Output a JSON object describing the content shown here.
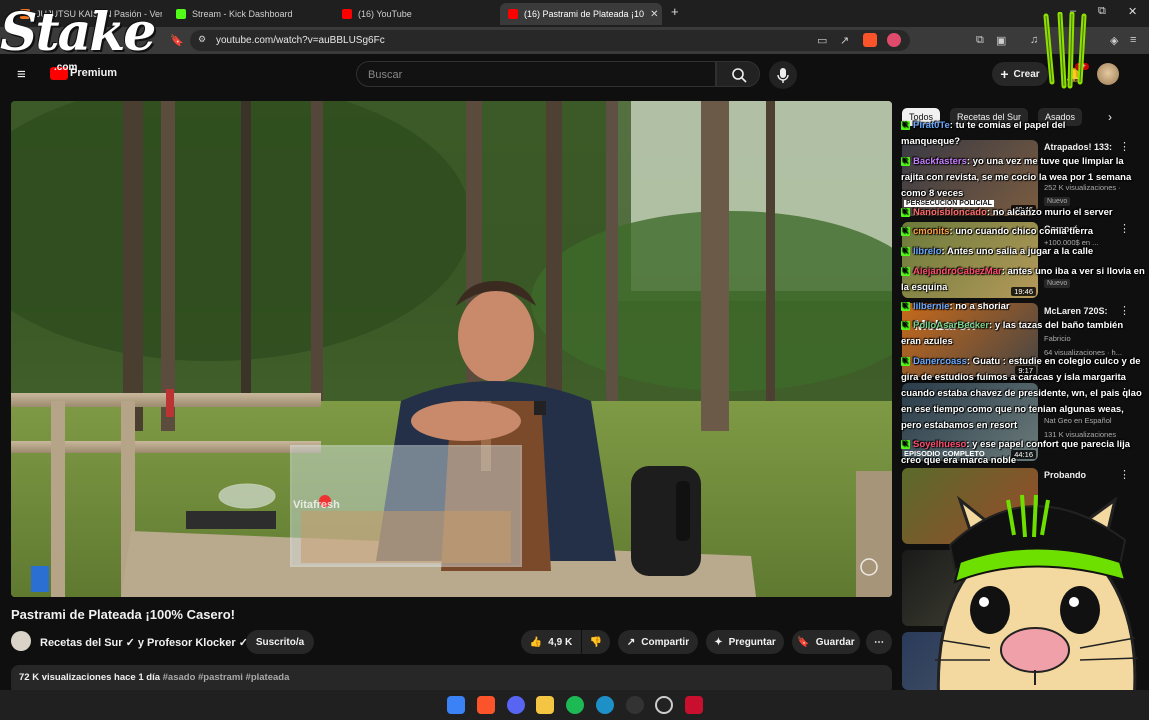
{
  "browser": {
    "tabs": [
      {
        "label": "JUJUTSU KAISEN Pasión - Ver en Cru",
        "color": "#f47521"
      },
      {
        "label": "Stream - Kick Dashboard",
        "color": "#53fc18"
      },
      {
        "label": "(16) YouTube",
        "color": "#ff0000"
      },
      {
        "label": "(16) Pastrami de Plateada ¡10",
        "color": "#ff0000"
      }
    ],
    "url": "youtube.com/watch?v=auBBLUSg6Fc",
    "new_tab": "+",
    "window_controls": [
      "–",
      "⧉",
      "✕"
    ]
  },
  "youtube": {
    "logo_badge": "Premium",
    "search_placeholder": "Buscar",
    "create_label": "Crear",
    "notif_count": "9+"
  },
  "video": {
    "title": "Pastrami de Plateada ¡100% Casero!",
    "channel": "Recetas del Sur ✓ y Profesor Klocker ✓",
    "subscribe_label": "Suscrito/a",
    "likes": "4,9 K",
    "share_label": "Compartir",
    "ask_label": "Preguntar",
    "save_label": "Guardar",
    "views_line": "72 K visualizaciones  hace 1 día",
    "tags": "#asado #pastrami #plateada",
    "box_text": "Vitafresh"
  },
  "chips": [
    "Todos",
    "Recetas del Sur",
    "Asados"
  ],
  "recommended": [
    {
      "title": "Atrapados! 133:",
      "meta": "252 K visualizaciones ·",
      "badge": "Nuevo",
      "duration": "40:46",
      "thumb_text": "PERSECUCIÓN POLICIAL"
    },
    {
      "title": "Compré",
      "meta": "+100.000$ en ...",
      "badge": "Nuevo",
      "duration": "19:46",
      "thumb_text": ""
    },
    {
      "title": "McLaren 720S:",
      "meta": "64 visualizaciones · h...",
      "sub": "Fabricio",
      "badge": "",
      "duration": "9:17",
      "thumb_text": "McLaren"
    },
    {
      "title": "",
      "meta": "131 K visualizaciones",
      "sub": "Nat Geo en Español",
      "badge": "",
      "duration": "44:16",
      "thumb_text": "EPISODIO COMPLETO"
    },
    {
      "title": "Probando",
      "meta": "",
      "badge": "",
      "duration": "",
      "thumb_text": ""
    }
  ],
  "chat": [
    {
      "user": "Pirat0Te",
      "color": "#6aa9ff",
      "text": ": tu te comias el papel del manqueque?",
      "wrap": true
    },
    {
      "user": "Backfasters",
      "color": "#c77dff",
      "text": ": yo una vez me tuve que limpiar la rajita con revista, se me cocio la wea por 1 semana como 8 veces",
      "wrap": true
    },
    {
      "user": "Nanoisbloncado",
      "color": "#ff6b6b",
      "text": ": no alcanzo murio el server",
      "wrap": false
    },
    {
      "user": "cmonits",
      "color": "#ff9f43",
      "text": ": uno cuando chico comia tierra",
      "wrap": false
    },
    {
      "user": "librelo",
      "color": "#6aa9ff",
      "text": ": Antes uno salia a jugar a la calle",
      "wrap": false
    },
    {
      "user": "AlejandroCabezMar",
      "color": "#ff4d6d",
      "text": ": antes uno iba a ver si llovia en la esquina",
      "wrap": true
    },
    {
      "user": "lilbernie",
      "color": "#6aa9ff",
      "text": ": no a shoriar",
      "wrap": false
    },
    {
      "user": "PolloAsarBecker",
      "color": "#7bd389",
      "text": ": y las tazas del baño también eran azules",
      "wrap": true
    },
    {
      "user": "Danercoass",
      "color": "#6aa9ff",
      "text": ": Guatu : estudie en colegio culco y de gira de estudios fuimos a caracas y isla margarita cuando estaba chavez de presidente, wn, el pais qlao en ese tiempo como que no tenian algunas weas, pero estabamos en resort",
      "wrap": true
    },
    {
      "user": "Soyelhueso",
      "color": "#ff4d6d",
      "text": ": y ese papel confort que parecia lija creo que era marca noble",
      "wrap": true
    }
  ],
  "overlay": {
    "stake_logo": "Stake",
    "stake_sub": ".com"
  },
  "taskbar": [
    "windows",
    "brave",
    "discord",
    "files",
    "spotify",
    "edge",
    "app",
    "obs",
    "app2"
  ]
}
